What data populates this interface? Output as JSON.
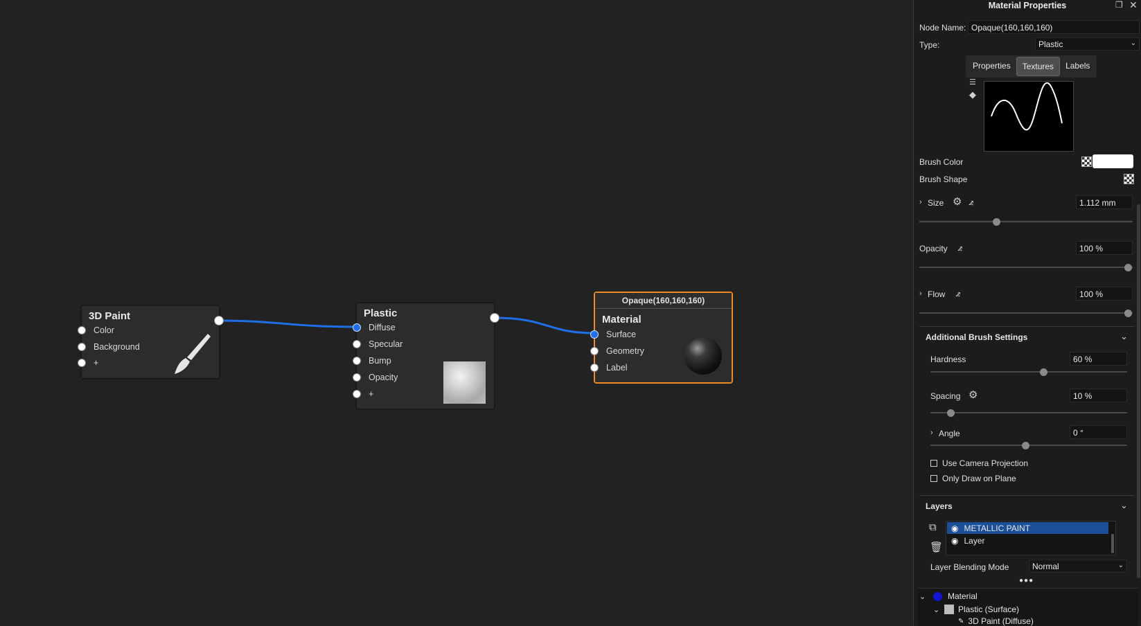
{
  "graph": {
    "paint_node": {
      "title": "3D Paint",
      "inputs": [
        "Color",
        "Background",
        "+"
      ]
    },
    "plastic_node": {
      "title": "Plastic",
      "inputs": [
        "Diffuse",
        "Specular",
        "Bump",
        "Opacity",
        "+"
      ]
    },
    "material_node": {
      "header": "Opaque(160,160,160)",
      "title": "Material",
      "inputs": [
        "Surface",
        "Geometry",
        "Label"
      ]
    },
    "wire_color": "#1f6fe8",
    "selection_color": "#f08a24"
  },
  "panel": {
    "title": "Material Properties",
    "node_name_label": "Node Name:",
    "node_name_value": "Opaque(160,160,160)",
    "type_label": "Type:",
    "type_value": "Plastic",
    "tabs": [
      "Properties",
      "Textures",
      "Labels"
    ],
    "active_tab": "Textures",
    "brush_color_label": "Brush Color",
    "brush_color": "#ffffff",
    "brush_shape_label": "Brush Shape",
    "size_label": "Size",
    "size_value": "1.112 mm",
    "size_level": 0.38,
    "opacity_label": "Opacity",
    "opacity_value": "100 %",
    "flow_label": "Flow",
    "flow_value": "100 %",
    "additional_label": "Additional Brush Settings",
    "hardness_label": "Hardness",
    "hardness_value": "60 %",
    "spacing_label": "Spacing",
    "spacing_value": "10 %",
    "angle_label": "Angle",
    "angle_value": "0 °",
    "use_camera_label": "Use Camera Projection",
    "only_plane_label": "Only Draw on Plane",
    "layers_label": "Layers",
    "layers": [
      "METALLIC PAINT",
      "Layer"
    ],
    "blend_label": "Layer Blending Mode",
    "blend_value": "Normal",
    "tree_material": "Material",
    "tree_plastic": "Plastic (Surface)",
    "tree_paint": "3D Paint (Diffuse)"
  }
}
